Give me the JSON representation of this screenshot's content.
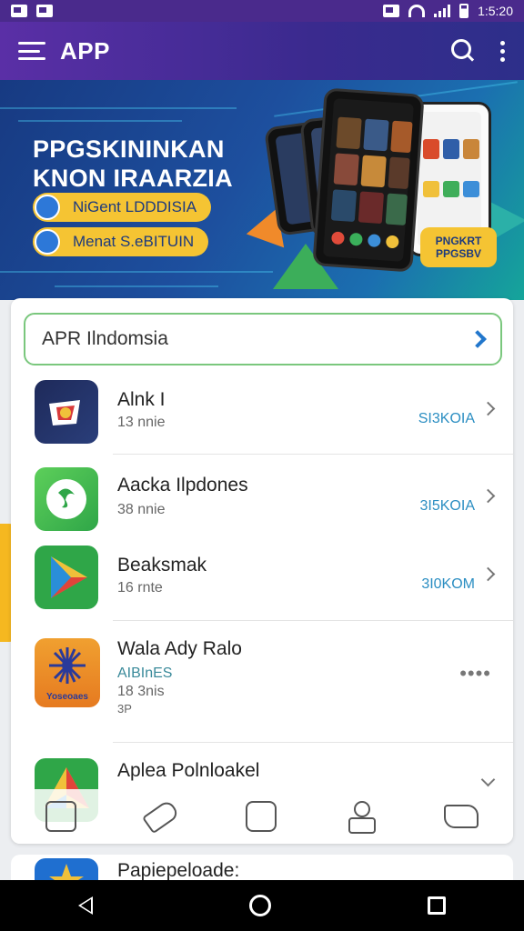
{
  "status_bar": {
    "time": "1:5:20",
    "icons": [
      "notification-icon",
      "image-icon",
      "cast-icon",
      "wifi-icon",
      "signal-icon",
      "battery-icon"
    ]
  },
  "app_bar": {
    "title": "APP",
    "icons": [
      "menu-icon",
      "search-icon",
      "more-vert-icon"
    ]
  },
  "banner": {
    "title_line1": "PPGSKININKAN",
    "title_line2": "KNON IRAARZIA",
    "pill1": "NiGent LDDDISIA",
    "pill2": "Menat S.eBITUIN",
    "badge_line1": "PNGKRT",
    "badge_line2": "PPGSBV",
    "colors": {
      "accent": "#f5c433",
      "deep": "#173a82",
      "teal": "#15a59a"
    }
  },
  "card": {
    "search_label": "APR Ilndomsia",
    "apps": [
      {
        "name": "Alnk I",
        "sub": "13 nnie",
        "price": "SI3KOIA"
      },
      {
        "name": "Aacka Ilpdones",
        "sub": "38 nnie",
        "price": "3I5KOIA"
      },
      {
        "name": "Beaksmak",
        "sub": "16 rnte",
        "price": "3I0KOM"
      },
      {
        "name": "Wala Ady Ralo",
        "sub": "AIBInES",
        "sub2": "18 3nis",
        "sub3": "3P",
        "icon_text": "Yoseoaes"
      },
      {
        "name": "Aplea Polnloakel"
      }
    ],
    "peek_name": "Papiepeloade:"
  },
  "bottom_icons": [
    "sim-card-icon",
    "tag-icon",
    "play-shield-icon",
    "person-icon",
    "scroll-icon"
  ],
  "nav_bar": [
    "back-icon",
    "home-icon",
    "recents-icon"
  ]
}
